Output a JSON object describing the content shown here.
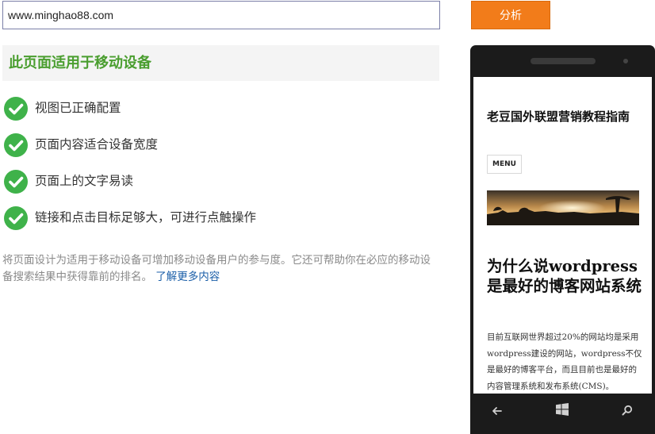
{
  "search": {
    "url_value": "www.minghao88.com",
    "analyze_label": "分析"
  },
  "result": {
    "title": "此页面适用于移动设备",
    "checks": [
      "视图已正确配置",
      "页面内容适合设备宽度",
      "页面上的文字易读",
      "链接和点击目标足够大，可进行点触操作"
    ],
    "description": "将页面设计为适用于移动设备可增加移动设备用户的参与度。它还可帮助你在必应的移动设备搜索结果中获得靠前的排名。",
    "learn_more_label": "了解更多内容"
  },
  "phone_preview": {
    "site_title": "老豆国外联盟营销教程指南",
    "menu_label": "MENU",
    "post_title": "为什么说wordpress是最好的博客网站系统",
    "post_excerpt": "目前互联网世界超过20%的网站均是采用wordpress建设的网站，wordpress不仅是最好的博客平台，而且目前也是最好的内容管理系统和发布系统(CMS)。"
  },
  "colors": {
    "accent_orange": "#f27c1a",
    "success_green": "#3fb24a",
    "title_green": "#4a9e2f",
    "link_blue": "#1a5ea8"
  },
  "icons": {
    "check": "check-circle-icon",
    "back": "back-arrow-icon",
    "home": "windows-logo-icon",
    "search": "search-icon"
  }
}
